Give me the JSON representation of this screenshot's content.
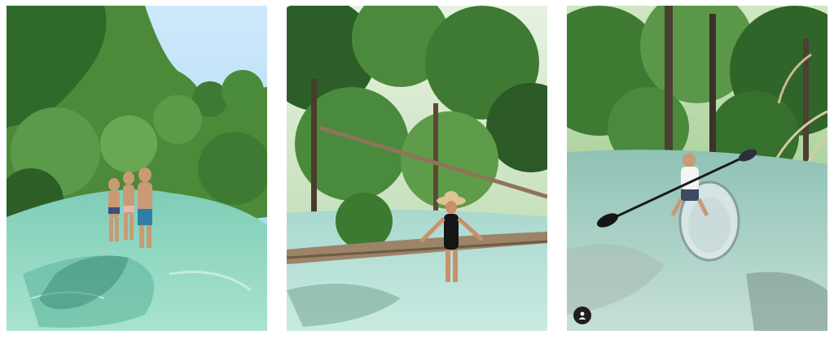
{
  "gallery": {
    "photos": [
      {
        "subject": "group-wading-spring-photo"
      },
      {
        "subject": "woman-sitting-on-log-photo"
      },
      {
        "subject": "man-in-clear-kayak-photo"
      }
    ],
    "user_badge": {
      "icon": "user-icon"
    }
  },
  "colors": {
    "water": "#9fd9c9",
    "foliage": "#3f7a34",
    "sky": "#bfe3f7",
    "kayak": "#e8eef0",
    "badge": "#1f1f1f"
  }
}
